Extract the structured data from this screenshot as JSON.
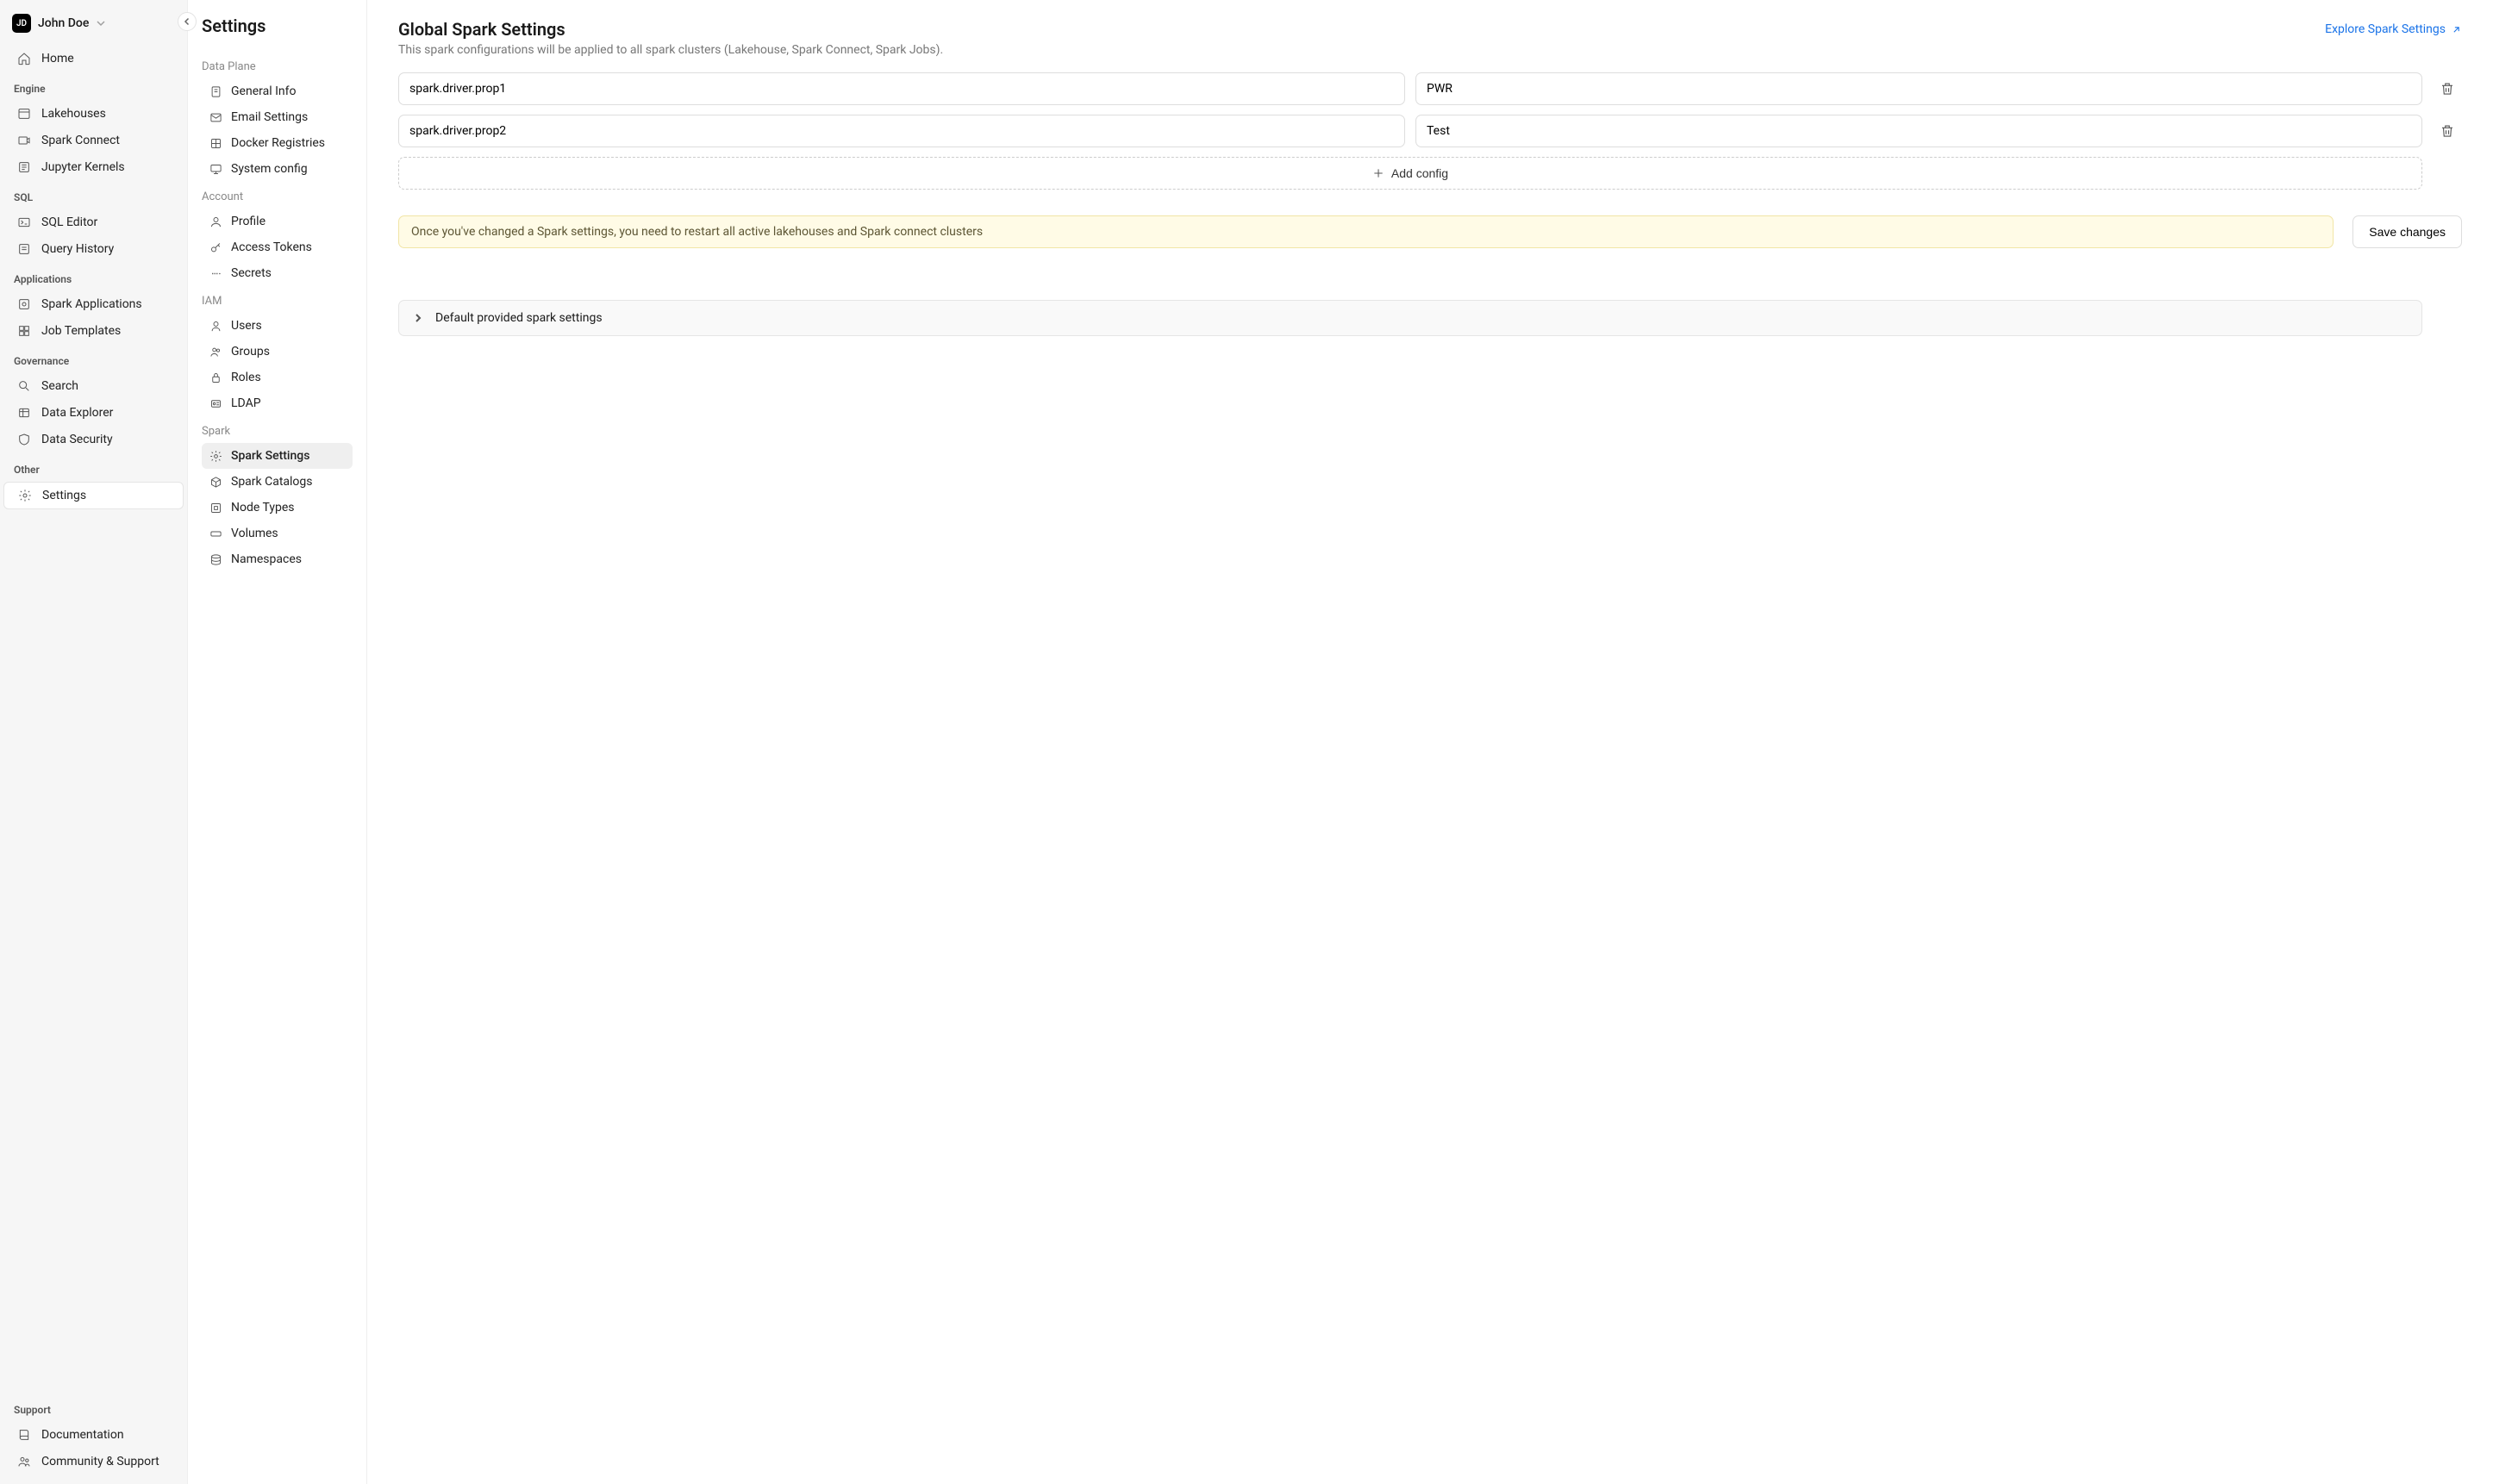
{
  "user": {
    "initials": "JD",
    "name": "John Doe"
  },
  "primaryNav": {
    "home": "Home",
    "groups": {
      "engine": {
        "label": "Engine",
        "items": [
          "Lakehouses",
          "Spark Connect",
          "Jupyter Kernels"
        ]
      },
      "sql": {
        "label": "SQL",
        "items": [
          "SQL Editor",
          "Query History"
        ]
      },
      "applications": {
        "label": "Applications",
        "items": [
          "Spark Applications",
          "Job Templates"
        ]
      },
      "governance": {
        "label": "Governance",
        "items": [
          "Search",
          "Data Explorer",
          "Data Security"
        ]
      },
      "other": {
        "label": "Other",
        "items": [
          "Settings"
        ]
      },
      "support": {
        "label": "Support",
        "items": [
          "Documentation",
          "Community & Support"
        ]
      }
    }
  },
  "settingsNav": {
    "title": "Settings",
    "groups": {
      "dataPlane": {
        "label": "Data Plane",
        "items": [
          "General Info",
          "Email Settings",
          "Docker Registries",
          "System config"
        ]
      },
      "account": {
        "label": "Account",
        "items": [
          "Profile",
          "Access Tokens",
          "Secrets"
        ]
      },
      "iam": {
        "label": "IAM",
        "items": [
          "Users",
          "Groups",
          "Roles",
          "LDAP"
        ]
      },
      "spark": {
        "label": "Spark",
        "items": [
          "Spark Settings",
          "Spark Catalogs",
          "Node Types",
          "Volumes",
          "Namespaces"
        ]
      }
    }
  },
  "main": {
    "title": "Global Spark Settings",
    "subtitle": "This spark configurations will be applied to all spark clusters (Lakehouse, Spark Connect, Spark Jobs).",
    "exploreLink": "Explore Spark Settings",
    "configs": [
      {
        "key": "spark.driver.prop1",
        "value": "PWR"
      },
      {
        "key": "spark.driver.prop2",
        "value": "Test"
      }
    ],
    "addConfig": "Add config",
    "warning": "Once you've changed a Spark settings, you need to restart all active lakehouses and Spark connect clusters",
    "saveButton": "Save changes",
    "expandable": "Default provided spark settings"
  }
}
